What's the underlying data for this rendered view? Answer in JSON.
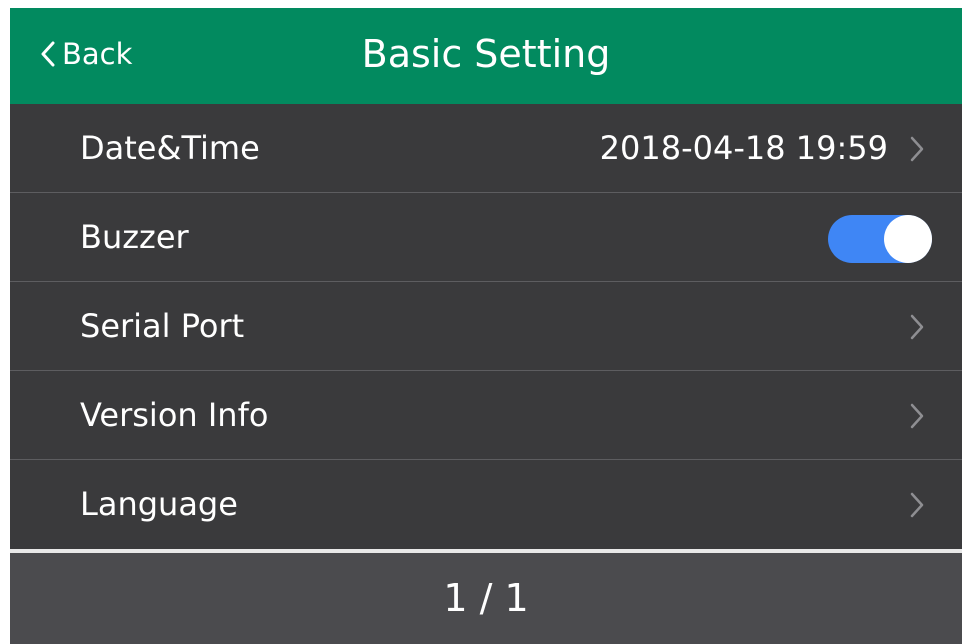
{
  "header": {
    "back_label": "Back",
    "title": "Basic Setting"
  },
  "settings": {
    "items": [
      {
        "label": "Date&Time",
        "value": "2018-04-18 19:59"
      },
      {
        "label": "Buzzer",
        "toggle_on": true
      },
      {
        "label": "Serial Port"
      },
      {
        "label": "Version Info"
      },
      {
        "label": "Language"
      }
    ]
  },
  "footer": {
    "page": "1 / 1"
  },
  "colors": {
    "header_bg": "#028a5f",
    "screen_bg": "#3a3a3c",
    "toggle_on": "#3f86f5",
    "footer_bg": "#4b4b4e"
  }
}
